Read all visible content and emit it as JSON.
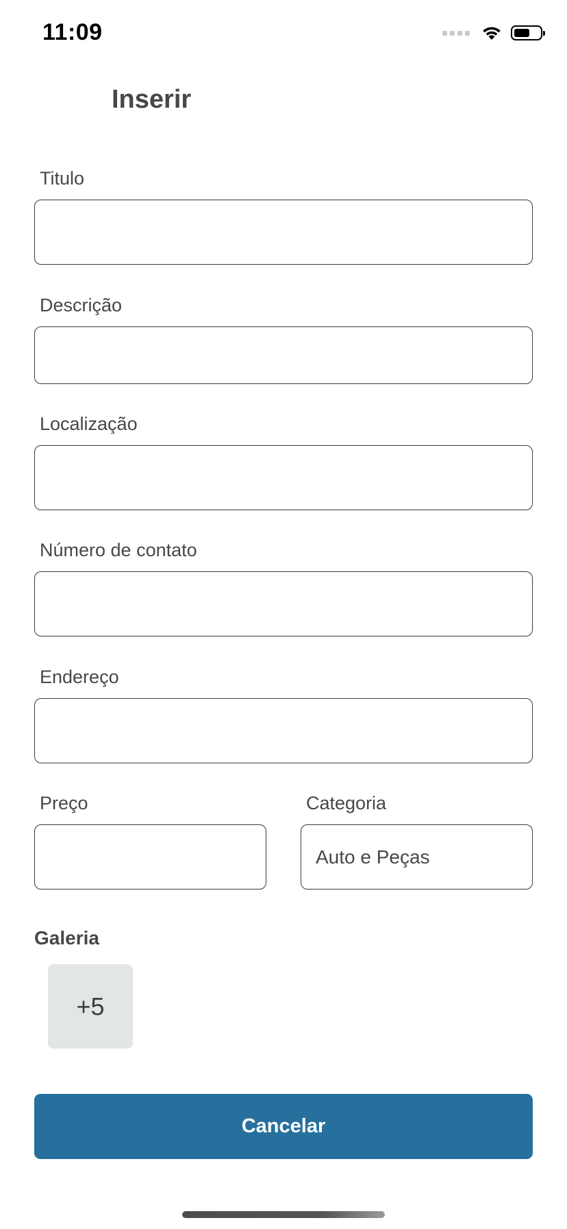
{
  "status_bar": {
    "time": "11:09",
    "battery_level": 0.6
  },
  "header": {
    "title": "Inserir"
  },
  "form": {
    "titulo": {
      "label": "Titulo",
      "value": ""
    },
    "descricao": {
      "label": "Descrição",
      "value": ""
    },
    "localizacao": {
      "label": "Localização",
      "value": ""
    },
    "numero_contato": {
      "label": "Número de contato",
      "value": ""
    },
    "endereco": {
      "label": "Endereço",
      "value": ""
    },
    "preco": {
      "label": "Preço",
      "value": ""
    },
    "categoria": {
      "label": "Categoria",
      "value": "Auto e Peças"
    }
  },
  "gallery": {
    "title": "Galeria",
    "more_count": "+5"
  },
  "actions": {
    "cancel_label": "Cancelar"
  },
  "colors": {
    "accent": "#27709d",
    "text": "#474747",
    "gallery_tile": "#e2e7e3"
  }
}
